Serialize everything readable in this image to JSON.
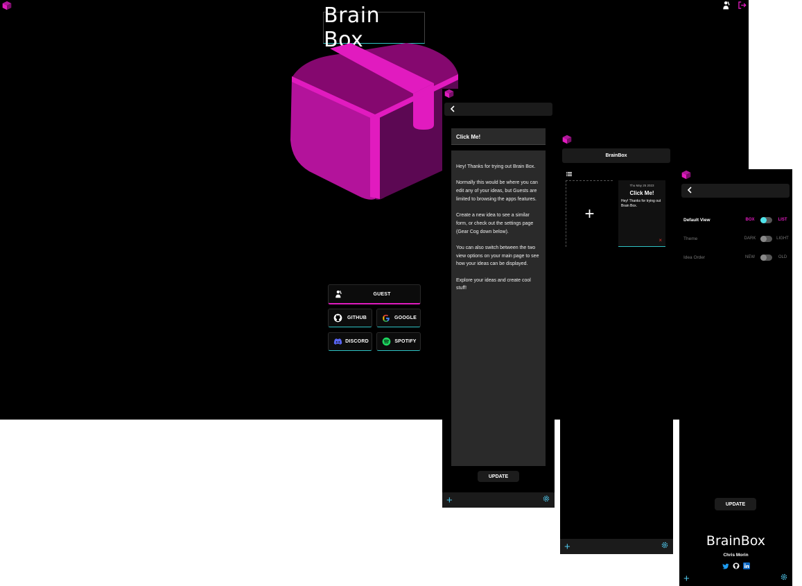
{
  "colors": {
    "magenta": "#e11bbf",
    "cyan": "#4fc6ea",
    "teal": "#2ec4c6",
    "red": "#e2312a",
    "panel_bg": "#000000",
    "card_bg": "#2a2a2a"
  },
  "login": {
    "app_title": "Brain Box",
    "buttons": {
      "guest": "GUEST",
      "github": "GITHUB",
      "google": "GOOGLE",
      "discord": "DISCORD",
      "spotify": "SPOTIFY"
    }
  },
  "editor": {
    "title_value": "Click Me!",
    "body_paragraphs": [
      "Hey! Thanks for trying out Brain Box.",
      "Normally this would be where you can edit any of your ideas, but Guests are limited to browsing the apps features.",
      "Create a new idea to see a similar form, or check out the settings page (Gear Cog down below).",
      "You can also switch between the two view options on your main page to see how your ideas can be displayed.",
      "Explore your ideas and create cool stuff!"
    ],
    "update_label": "UPDATE"
  },
  "home": {
    "title": "BrainBox",
    "add_symbol": "+",
    "card": {
      "date": "Thu May 25 2023",
      "title": "Click Me!",
      "snippet": "Hey! Thanks for trying out Brain Box.",
      "delete_symbol": "×"
    }
  },
  "settings": {
    "rows": [
      {
        "name": "Default View",
        "left": "BOX",
        "right": "LIST"
      },
      {
        "name": "Theme",
        "left": "DARK",
        "right": "LIGHT"
      },
      {
        "name": "Idea Order",
        "left": "NEW",
        "right": "OLD"
      }
    ],
    "update_label": "UPDATE",
    "footer_title": "BrainBox",
    "author": "Chris Morin"
  }
}
